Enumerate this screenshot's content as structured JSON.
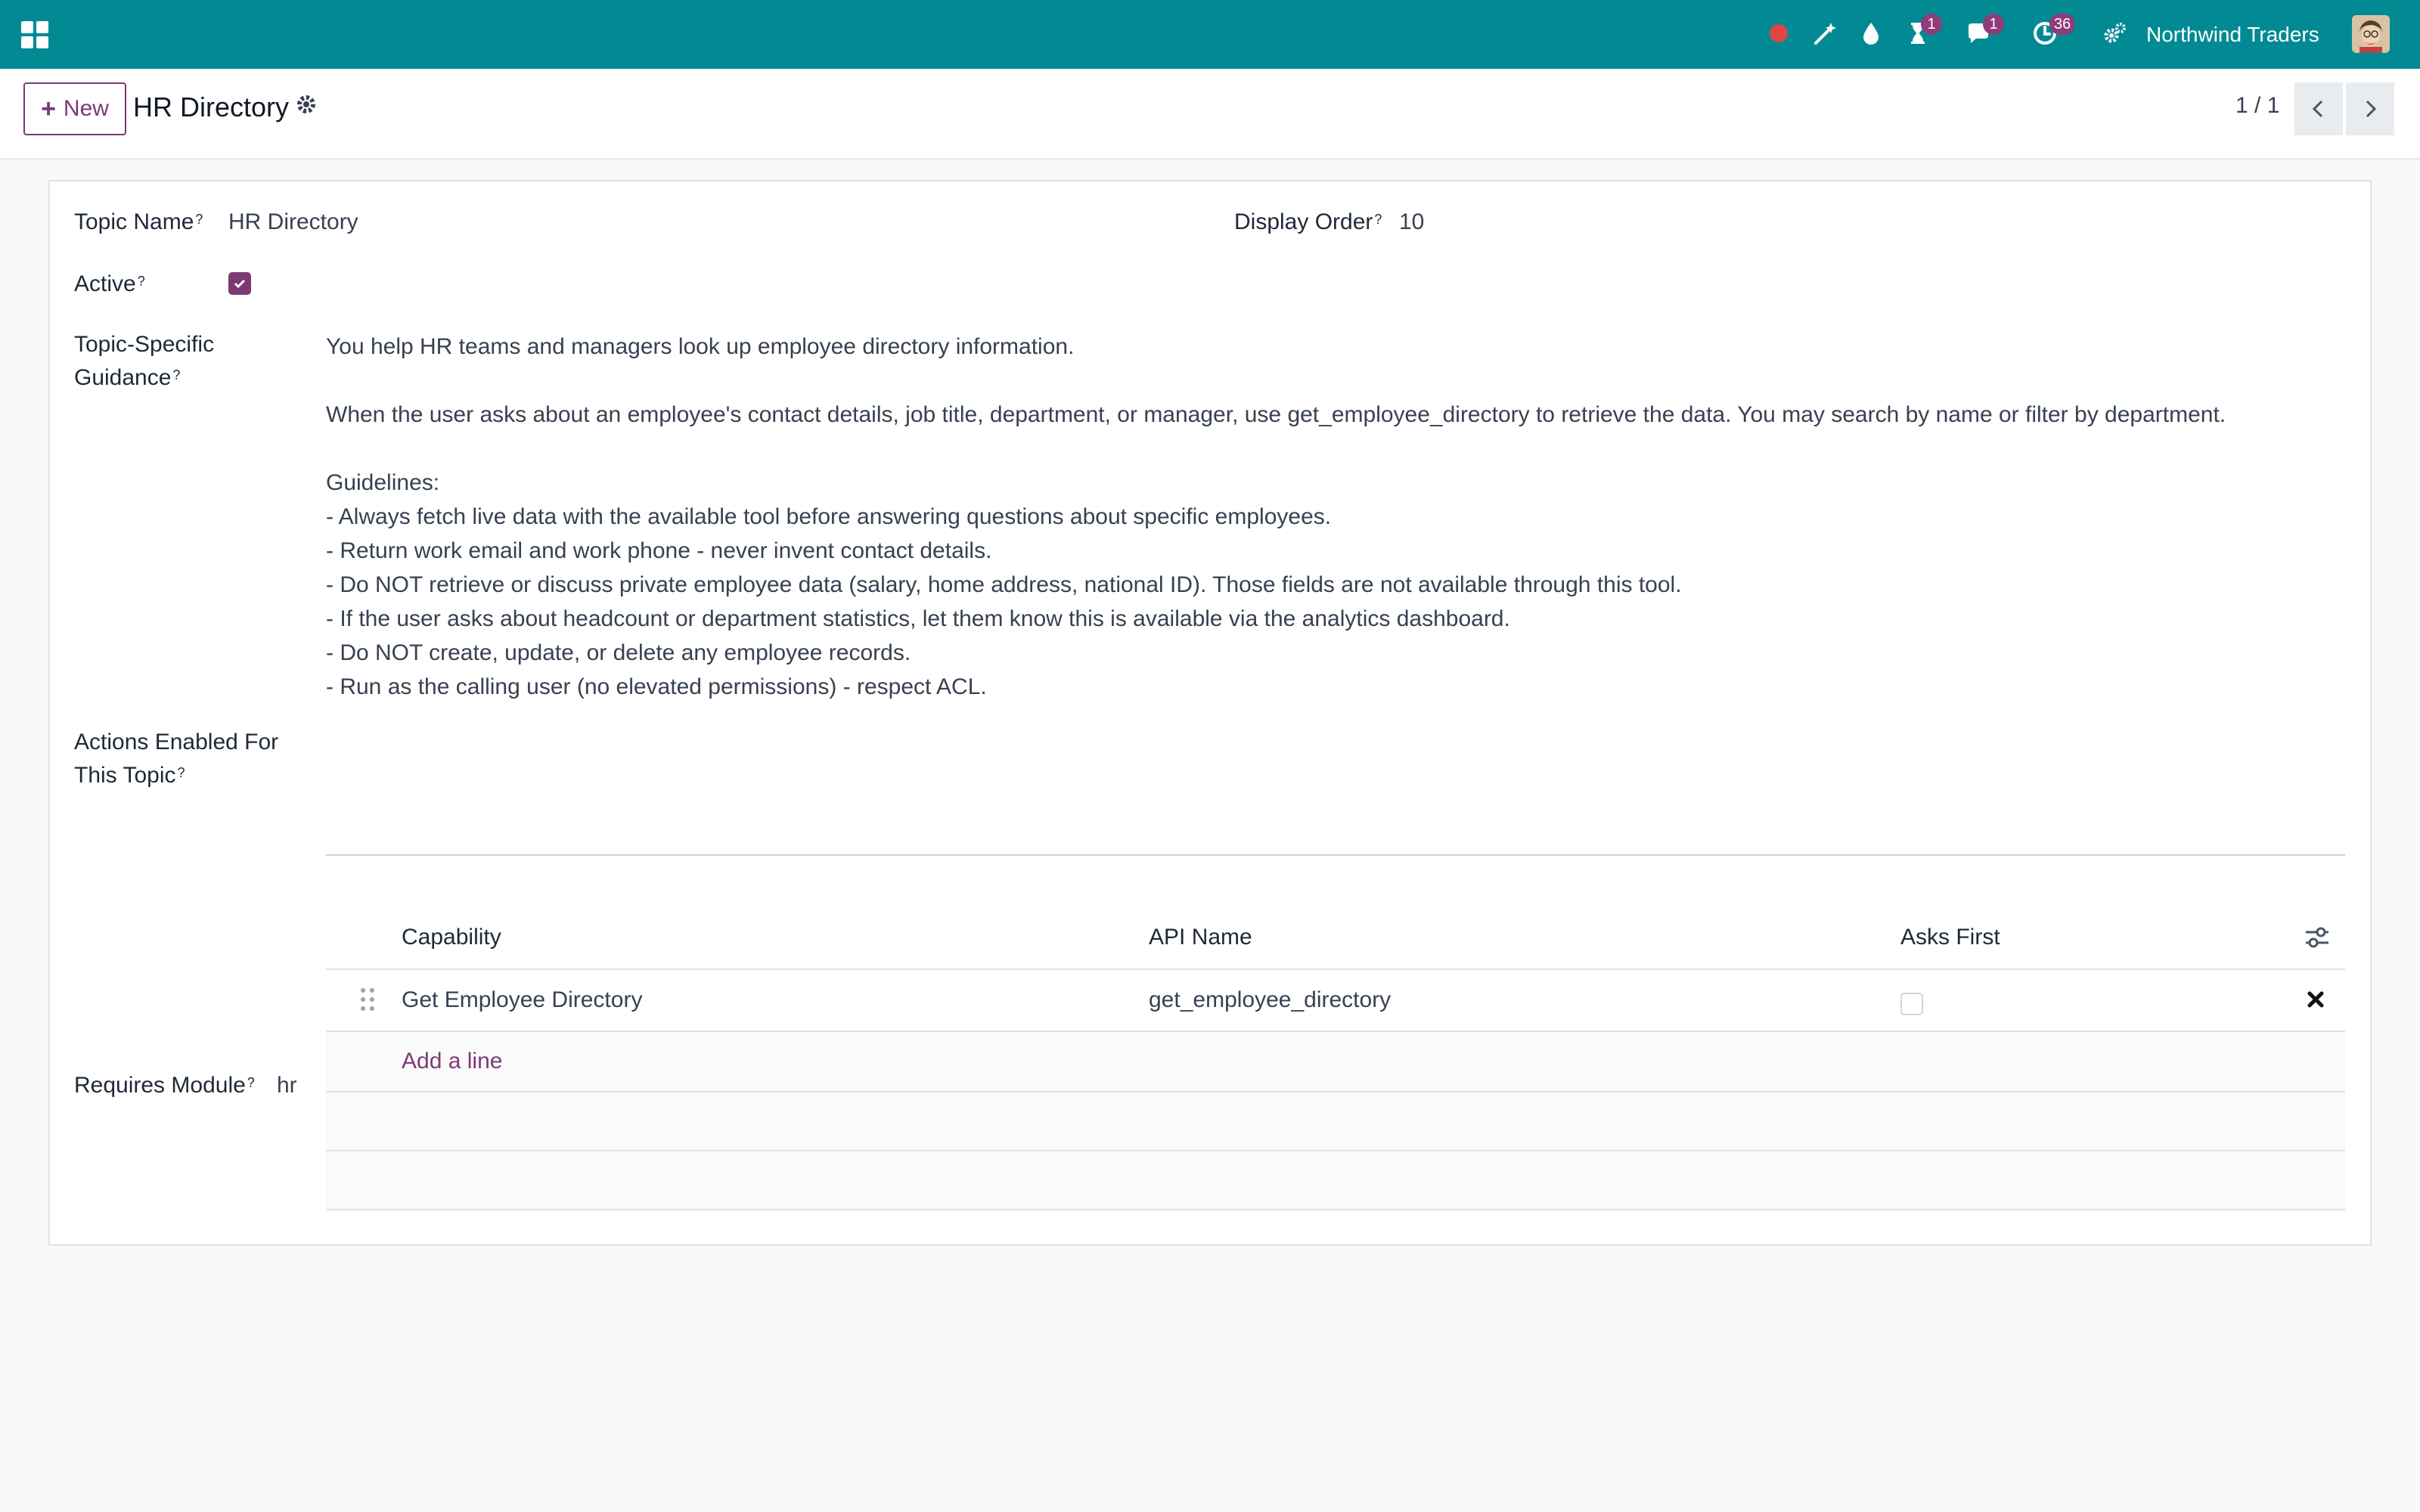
{
  "navbar": {
    "icons": [
      "apps-icon",
      "record-dot-icon",
      "magic-wand-icon",
      "drop-icon",
      "hourglass-icon",
      "chat-icon",
      "clock-icon",
      "gears-icon"
    ],
    "hourglass_badge": "1",
    "chat_badge": "1",
    "activity_badge": "36",
    "company": "Northwind Traders",
    "colors": {
      "background": "#018a94",
      "badge": "#8f3c7b",
      "record_dot": "#e04444"
    }
  },
  "control_panel": {
    "new_label": "New",
    "title": "HR Directory",
    "pager": "1 / 1"
  },
  "form": {
    "topic_name_label": "Topic Name",
    "topic_name_value": "HR Directory",
    "display_order_label": "Display Order",
    "display_order_value": "10",
    "active_label": "Active",
    "active_value": true,
    "guidance_label": "Topic-Specific Guidance",
    "guidance_text": "You help HR teams and managers look up employee directory information.\n\nWhen the user asks about an employee's contact details, job title, department, or manager, use get_employee_directory to retrieve the data. You may search by name or filter by department.\n\nGuidelines:\n- Always fetch live data with the available tool before answering questions about specific employees.\n- Return work email and work phone - never invent contact details.\n- Do NOT retrieve or discuss private employee data (salary, home address, national ID). Those fields are not available through this tool.\n- If the user asks about headcount or department statistics, let them know this is available via the analytics dashboard.\n- Do NOT create, update, or delete any employee records.\n- Run as the calling user (no elevated permissions) - respect ACL.",
    "actions_label": "Actions Enabled For This Topic",
    "requires_module_label": "Requires Module",
    "requires_module_value": "hr",
    "help_marker": "?"
  },
  "actions_table": {
    "headers": {
      "capability": "Capability",
      "api_name": "API Name",
      "asks_first": "Asks First"
    },
    "rows": [
      {
        "capability": "Get Employee Directory",
        "api_name": "get_employee_directory",
        "asks_first": false
      }
    ],
    "add_line_label": "Add a line"
  },
  "theme": {
    "primary": "#7c3a74"
  }
}
